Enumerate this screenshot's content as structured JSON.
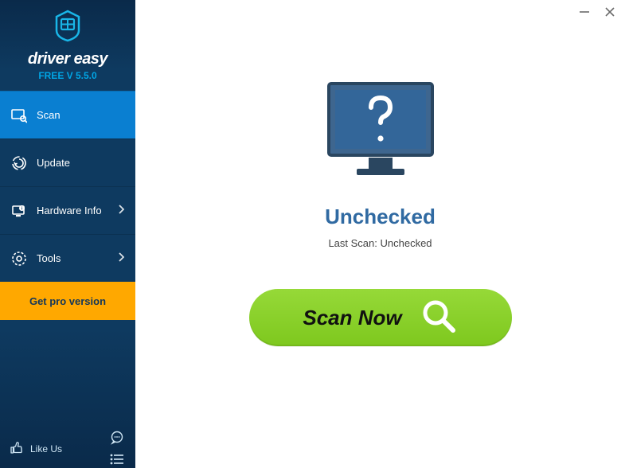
{
  "app": {
    "brand": "driver easy",
    "version": "FREE V 5.5.0"
  },
  "sidebar": {
    "items": [
      {
        "label": "Scan",
        "has_sub": false,
        "active": true
      },
      {
        "label": "Update",
        "has_sub": false,
        "active": false
      },
      {
        "label": "Hardware Info",
        "has_sub": true,
        "active": false
      },
      {
        "label": "Tools",
        "has_sub": true,
        "active": false
      }
    ],
    "pro_label": "Get pro version",
    "like_label": "Like Us"
  },
  "main": {
    "status_title": "Unchecked",
    "status_sub": "Last Scan: Unchecked",
    "scan_button_label": "Scan Now"
  },
  "colors": {
    "accent": "#0a7fd1",
    "pro": "#ffa800",
    "scan": "#8dc63f",
    "status_title": "#306aa2"
  }
}
